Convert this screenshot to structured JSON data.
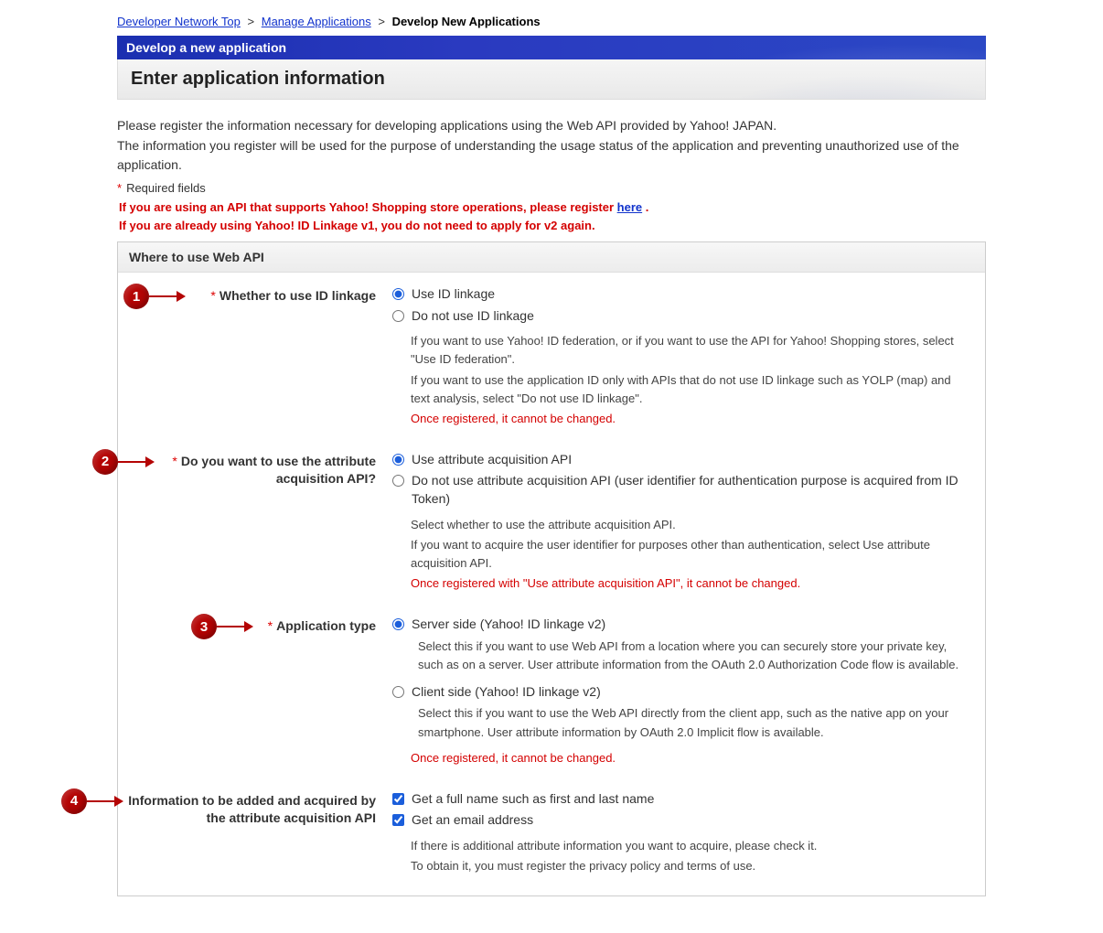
{
  "breadcrumb": {
    "item1": "Developer Network Top",
    "item2": "Manage Applications",
    "current": "Develop New Applications",
    "sep": ">"
  },
  "header": {
    "blue": "Develop a new application",
    "gray": "Enter application information"
  },
  "intro": {
    "p1": "Please register the information necessary for developing applications using the Web API provided by Yahoo! JAPAN.",
    "p2": "The information you register will be used for the purpose of understanding the usage status of the application and preventing unauthorized use of the application."
  },
  "required_label": "Required fields",
  "notice1_a": "If you are using an API that supports Yahoo! Shopping store operations, please register ",
  "notice1_link": "here",
  "notice1_b": " .",
  "notice2": "If you are already using Yahoo! ID Linkage v1, you do not need to apply for v2 again.",
  "section_title": "Where to use Web API",
  "markers": {
    "m1": "1",
    "m2": "2",
    "m3": "3",
    "m4": "4"
  },
  "row1": {
    "label": "Whether to use ID linkage",
    "opt1": "Use ID linkage",
    "opt2": "Do not use ID linkage",
    "help1": "If you want to use Yahoo! ID federation, or if you want to use the API for Yahoo! Shopping stores, select \"Use ID federation\".",
    "help2": "If you want to use the application ID only with APIs that do not use ID linkage such as YOLP (map) and text analysis, select \"Do not use ID linkage\".",
    "warn": "Once registered, it cannot be changed."
  },
  "row2": {
    "label": "Do you want to use the attribute acquisition API?",
    "opt1": "Use attribute acquisition API",
    "opt2": "Do not use attribute acquisition API (user identifier for authentication purpose is acquired from ID Token)",
    "help1": "Select whether to use the attribute acquisition API.",
    "help2": "If you want to acquire the user identifier for purposes other than authentication, select Use attribute acquisition API.",
    "warn": "Once registered with \"Use attribute acquisition API\", it cannot be changed."
  },
  "row3": {
    "label": "Application type",
    "opt1": "Server side (Yahoo! ID linkage v2)",
    "opt1_help": "Select this if you want to use Web API from a location where you can securely store your private key, such as on a server. User attribute information from the OAuth 2.0 Authorization Code flow is available.",
    "opt2": "Client side (Yahoo! ID linkage v2)",
    "opt2_help": "Select this if you want to use the Web API directly from the client app, such as the native app on your smartphone. User attribute information by OAuth 2.0 Implicit flow is available.",
    "warn": "Once registered, it cannot be changed."
  },
  "row4": {
    "label": "Information to be added and acquired by the attribute acquisition API",
    "opt1": "Get a full name such as first and last name",
    "opt2": "Get an email address",
    "help1": "If there is additional attribute information you want to acquire, please check it.",
    "help2": "To obtain it, you must register the privacy policy and terms of use."
  }
}
